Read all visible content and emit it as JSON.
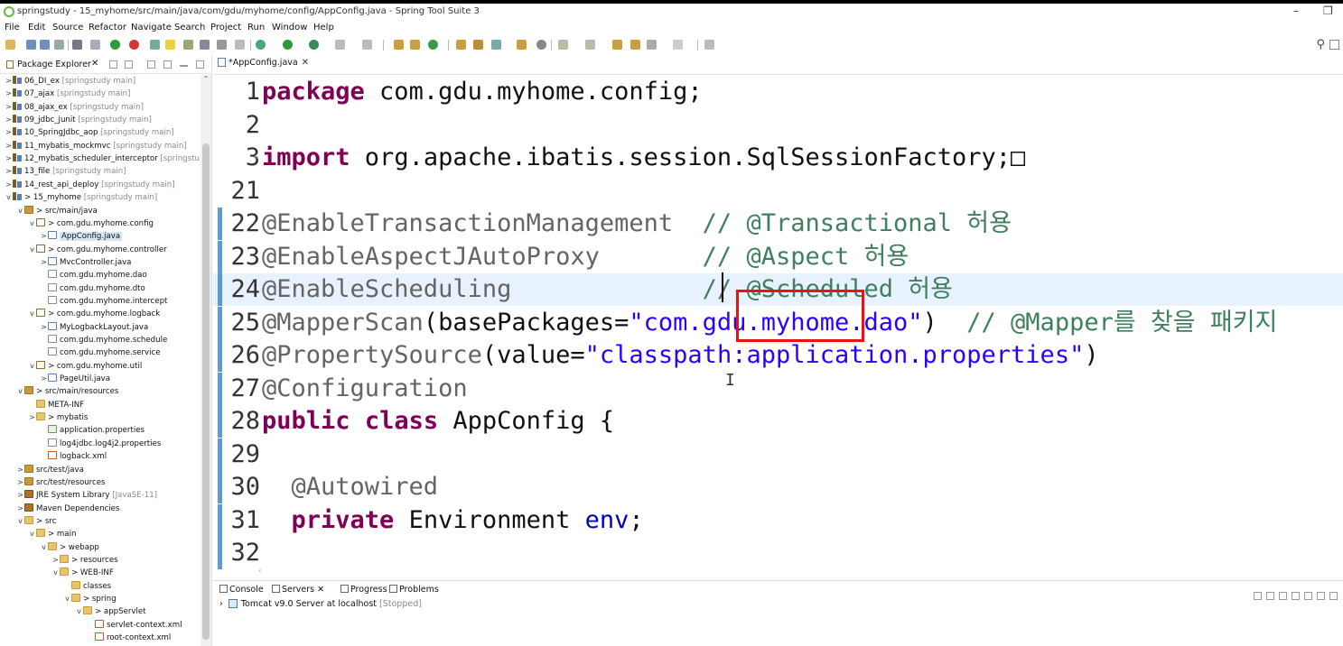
{
  "window": {
    "title": "springstudy - 15_myhome/src/main/java/com/gdu/myhome/config/AppConfig.java - Spring Tool Suite 3",
    "minimize": "–",
    "restore": "❐"
  },
  "menu": [
    "File",
    "Edit",
    "Source",
    "Refactor",
    "Navigate",
    "Search",
    "Project",
    "Run",
    "Window",
    "Help"
  ],
  "package_explorer": {
    "title": "Package Explorer",
    "close": "✕",
    "items": [
      {
        "label": "06_DI_ex",
        "deco": "[springstudy main]",
        "icon": "project",
        "twisty": ">"
      },
      {
        "label": "07_ajax",
        "deco": "[springstudy main]",
        "icon": "project",
        "twisty": ">"
      },
      {
        "label": "08_ajax_ex",
        "deco": "[springstudy main]",
        "icon": "project",
        "twisty": ">"
      },
      {
        "label": "09_jdbc_junit",
        "deco": "[springstudy main]",
        "icon": "project",
        "twisty": ">"
      },
      {
        "label": "10_SpringJdbc_aop",
        "deco": "[springstudy main]",
        "icon": "project",
        "twisty": ">"
      },
      {
        "label": "11_mybatis_mockmvc",
        "deco": "[springstudy main]",
        "icon": "project",
        "twisty": ">"
      },
      {
        "label": "12_mybatis_scheduler_interceptor",
        "deco": "[springstu",
        "icon": "project",
        "twisty": ">"
      },
      {
        "label": "13_file",
        "deco": "[springstudy main]",
        "icon": "project",
        "twisty": ">"
      },
      {
        "label": "14_rest_api_deploy",
        "deco": "[springstudy main]",
        "icon": "project",
        "twisty": ">"
      },
      {
        "label": "> 15_myhome",
        "deco": "[springstudy main]",
        "icon": "project",
        "twisty": "v"
      },
      {
        "label": "> src/main/java",
        "deco": "",
        "icon": "srcfolder",
        "twisty": "v"
      },
      {
        "label": "> com.gdu.myhome.config",
        "deco": "",
        "icon": "package",
        "twisty": "v"
      },
      {
        "label": "AppConfig.java",
        "deco": "",
        "icon": "java",
        "twisty": ">",
        "selected": true
      },
      {
        "label": "> com.gdu.myhome.controller",
        "deco": "",
        "icon": "package",
        "twisty": "v"
      },
      {
        "label": "MvcController.java",
        "deco": "",
        "icon": "java",
        "twisty": ">"
      },
      {
        "label": "com.gdu.myhome.dao",
        "deco": "",
        "icon": "package-empty",
        "twisty": ""
      },
      {
        "label": "com.gdu.myhome.dto",
        "deco": "",
        "icon": "package-empty",
        "twisty": ""
      },
      {
        "label": "com.gdu.myhome.intercept",
        "deco": "",
        "icon": "package-empty",
        "twisty": ""
      },
      {
        "label": "> com.gdu.myhome.logback",
        "deco": "",
        "icon": "package",
        "twisty": "v"
      },
      {
        "label": "MyLogbackLayout.java",
        "deco": "",
        "icon": "java",
        "twisty": ">"
      },
      {
        "label": "com.gdu.myhome.schedule",
        "deco": "",
        "icon": "package-empty",
        "twisty": ""
      },
      {
        "label": "com.gdu.myhome.service",
        "deco": "",
        "icon": "package-empty",
        "twisty": ""
      },
      {
        "label": "> com.gdu.myhome.util",
        "deco": "",
        "icon": "package",
        "twisty": "v"
      },
      {
        "label": "PageUtil.java",
        "deco": "",
        "icon": "java",
        "twisty": ">"
      },
      {
        "label": "> src/main/resources",
        "deco": "",
        "icon": "srcfolder",
        "twisty": "v"
      },
      {
        "label": "META-INF",
        "deco": "",
        "icon": "folder",
        "twisty": ""
      },
      {
        "label": "> mybatis",
        "deco": "",
        "icon": "folder",
        "twisty": ">"
      },
      {
        "label": "application.properties",
        "deco": "",
        "icon": "props",
        "twisty": ""
      },
      {
        "label": "log4jdbc.log4j2.properties",
        "deco": "",
        "icon": "file",
        "twisty": ""
      },
      {
        "label": "logback.xml",
        "deco": "",
        "icon": "xml",
        "twisty": ""
      },
      {
        "label": "src/test/java",
        "deco": "",
        "icon": "srcfolder",
        "twisty": ">"
      },
      {
        "label": "src/test/resources",
        "deco": "",
        "icon": "srcfolder",
        "twisty": ">"
      },
      {
        "label": "JRE System Library",
        "deco": "[JavaSE-11]",
        "icon": "lib",
        "twisty": ">"
      },
      {
        "label": "Maven Dependencies",
        "deco": "",
        "icon": "lib",
        "twisty": ">"
      },
      {
        "label": "> src",
        "deco": "",
        "icon": "folder",
        "twisty": "v"
      },
      {
        "label": "> main",
        "deco": "",
        "icon": "folder",
        "twisty": "v"
      },
      {
        "label": "> webapp",
        "deco": "",
        "icon": "folder",
        "twisty": "v"
      },
      {
        "label": "> resources",
        "deco": "",
        "icon": "folder",
        "twisty": ">"
      },
      {
        "label": "> WEB-INF",
        "deco": "",
        "icon": "folder",
        "twisty": "v"
      },
      {
        "label": "classes",
        "deco": "",
        "icon": "folder",
        "twisty": ""
      },
      {
        "label": "> spring",
        "deco": "",
        "icon": "folder",
        "twisty": "v"
      },
      {
        "label": "> appServlet",
        "deco": "",
        "icon": "folder",
        "twisty": "v"
      },
      {
        "label": "servlet-context.xml",
        "deco": "",
        "icon": "xml",
        "twisty": ""
      },
      {
        "label": "root-context.xml",
        "deco": "",
        "icon": "xml",
        "twisty": ""
      }
    ]
  },
  "editor": {
    "tab_label": "*AppConfig.java",
    "tab_close": "✕",
    "lines": [
      {
        "num": "1",
        "tokens": [
          {
            "t": "package",
            "c": "kw"
          },
          {
            "t": " com.gdu.myhome.config;",
            "c": ""
          }
        ]
      },
      {
        "num": "2",
        "tokens": []
      },
      {
        "num": "3",
        "fold": "+",
        "tokens": [
          {
            "t": "import",
            "c": "kw"
          },
          {
            "t": " org.apache.ibatis.session.SqlSessionFactory;",
            "c": ""
          },
          {
            "t": "□",
            "c": ""
          }
        ]
      },
      {
        "num": "21",
        "tokens": []
      },
      {
        "num": "22",
        "bar": true,
        "tokens": [
          {
            "t": "@EnableTransactionManagement",
            "c": "ann"
          },
          {
            "t": "  ",
            "c": ""
          },
          {
            "t": "// @Transactional 허용",
            "c": "cm"
          }
        ]
      },
      {
        "num": "23",
        "bar": true,
        "tokens": [
          {
            "t": "@EnableAspectJAutoProxy",
            "c": "ann"
          },
          {
            "t": "       ",
            "c": ""
          },
          {
            "t": "// @Aspect 허용",
            "c": "cm"
          }
        ]
      },
      {
        "num": "24",
        "bar": true,
        "current": true,
        "tokens": [
          {
            "t": "@EnableScheduling",
            "c": "ann"
          },
          {
            "t": "             ",
            "c": ""
          },
          {
            "t": "// @Scheduled 허용",
            "c": "cm"
          }
        ]
      },
      {
        "num": "25",
        "bar": true,
        "tokens": [
          {
            "t": "@MapperScan",
            "c": "ann"
          },
          {
            "t": "(basePackages=",
            "c": ""
          },
          {
            "t": "\"com.gdu.myhome.dao\"",
            "c": "str"
          },
          {
            "t": ")  ",
            "c": ""
          },
          {
            "t": "// @Mapper를 찾을 패키지",
            "c": "cm"
          }
        ]
      },
      {
        "num": "26",
        "bar": true,
        "tokens": [
          {
            "t": "@PropertySource",
            "c": "ann"
          },
          {
            "t": "(value=",
            "c": ""
          },
          {
            "t": "\"classpath:application.properties\"",
            "c": "str"
          },
          {
            "t": ")",
            "c": ""
          }
        ]
      },
      {
        "num": "27",
        "bar": true,
        "tokens": [
          {
            "t": "@Configuration",
            "c": "ann"
          }
        ]
      },
      {
        "num": "28",
        "bar": true,
        "tokens": [
          {
            "t": "public",
            "c": "kw"
          },
          {
            "t": " ",
            "c": ""
          },
          {
            "t": "class",
            "c": "kw"
          },
          {
            "t": " AppConfig {",
            "c": ""
          }
        ]
      },
      {
        "num": "29",
        "bar": true,
        "tokens": []
      },
      {
        "num": "30",
        "bar": true,
        "fold": "-",
        "tokens": [
          {
            "t": "  @Autowired",
            "c": "ann"
          }
        ]
      },
      {
        "num": "31",
        "bar": true,
        "tokens": [
          {
            "t": "  ",
            "c": ""
          },
          {
            "t": "private",
            "c": "kw"
          },
          {
            "t": " Environment ",
            "c": ""
          },
          {
            "t": "env",
            "c": "fld"
          },
          {
            "t": ";",
            "c": ""
          }
        ]
      },
      {
        "num": "32",
        "bar": true,
        "tokens": []
      }
    ]
  },
  "bottom": {
    "tabs": [
      {
        "label": "Console",
        "icon": "console-icon"
      },
      {
        "label": "Servers",
        "icon": "servers-icon",
        "close": "✕"
      },
      {
        "label": "Progress",
        "icon": "progress-icon"
      },
      {
        "label": "Problems",
        "icon": "problems-icon"
      }
    ],
    "server": {
      "name": "Tomcat v9.0 Server at localhost",
      "status": "[Stopped]"
    }
  }
}
